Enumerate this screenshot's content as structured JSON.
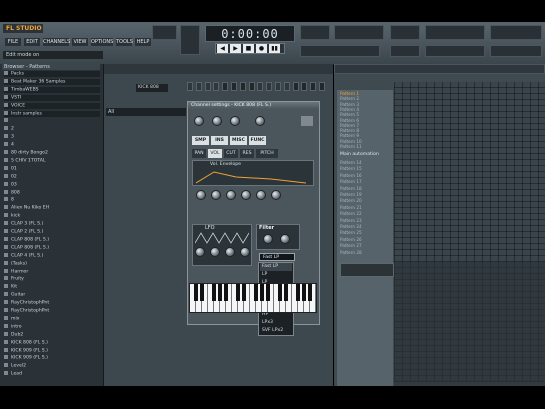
{
  "app": {
    "logo": "FL STUDIO",
    "time": "0:00:00",
    "hint_bar": "Edit mode on"
  },
  "menu": [
    "FILE",
    "EDIT",
    "CHANNELS",
    "VIEW",
    "OPTIONS",
    "TOOLS",
    "HELP"
  ],
  "transport": {
    "buttons": [
      "◀",
      "▶",
      "■",
      "●",
      "▮▮"
    ]
  },
  "browser": {
    "title": "Browser - Patterns",
    "items": [
      "Packs",
      "Beat Maker 36 Samples",
      "TimbaWEBS",
      "VSTI",
      "VOICE",
      "Instr samples",
      "",
      "2",
      "3",
      "4",
      "80 dirty Bongo2",
      "5 CHIV 1TOTAL",
      "01",
      "02",
      "03",
      "808",
      "8",
      "Alien Nu Kiko EH",
      "kick",
      "CLAP 3 (FL S.)",
      "CLAP 2 (FL S.)",
      "CLAP 808 (FL S.)",
      "CLAP 808 (FL S.)",
      "CLAP 4 (FL S.)",
      "(Tasks)",
      "Harmor",
      "Fruity",
      "Kit",
      "Guitar",
      "RayChristophPnt",
      "RayChristophPnt",
      "mix",
      "intro",
      "Dub2",
      "KICK 808 (FL S.)",
      "KICK 909 (FL S.)",
      "KICK 909 (FL S.)",
      "Level2",
      "Lead"
    ]
  },
  "sequencer": {
    "channel_name": "KICK 808",
    "left_label": "All"
  },
  "channel_window": {
    "title": "Channel settings - KICK 808 (FL S.)",
    "tabs_row1": [
      "SMP",
      "INS",
      "MISC",
      "FUNC"
    ],
    "tabs_row2": [
      "PAN",
      "VOL",
      "CUT",
      "RES",
      "PITCH"
    ],
    "envelope_label": "Vol. Envelope",
    "lfo_label": "LFO",
    "filter": {
      "label": "Filter",
      "selected": "Fast LP",
      "options": [
        "Fast LP",
        "LP",
        "LP",
        "BP",
        "Notch",
        "LPx2",
        "HP",
        "LPx3",
        "SVF LPx2"
      ]
    }
  },
  "playlist": {
    "patterns": [
      "Pattern 1",
      "Pattern 2",
      "Pattern 3",
      "Pattern 4",
      "Pattern 5",
      "Pattern 6",
      "Pattern 7",
      "Pattern 8",
      "Pattern 9",
      "Pattern 10",
      "Pattern 11"
    ],
    "automation_label": "Main automation",
    "patterns_after": [
      "Pattern 14",
      "Pattern 15",
      "Pattern 16",
      "Pattern 17",
      "Pattern 18",
      "Pattern 19",
      "Pattern 20",
      "Pattern 21",
      "Pattern 22",
      "Pattern 23",
      "Pattern 24",
      "Pattern 25",
      "Pattern 26",
      "Pattern 27",
      "Pattern 28"
    ]
  }
}
